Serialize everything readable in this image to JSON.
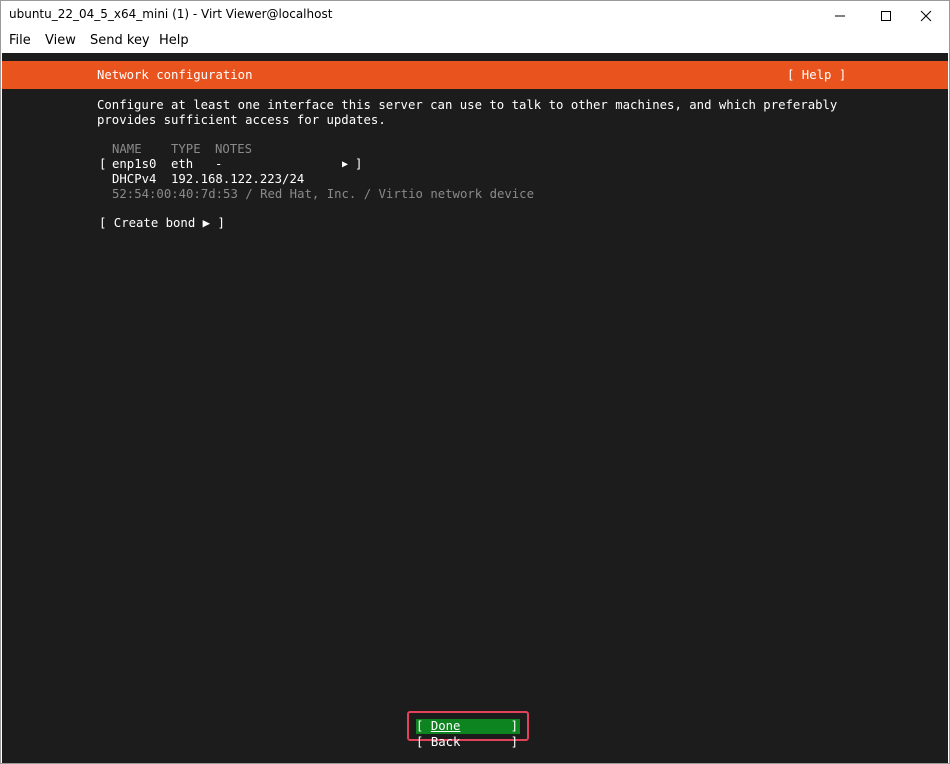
{
  "window": {
    "title": "ubuntu_22_04_5_x64_mini (1) - Virt Viewer@localhost",
    "controls": [
      "minimize",
      "maximize",
      "close"
    ]
  },
  "menu": {
    "items": [
      "File",
      "View",
      "Send key",
      "Help"
    ]
  },
  "installer": {
    "header_title": "Network configuration",
    "help_label": "[ Help ]",
    "description_line1": "Configure at least one interface this server can use to talk to other machines, and which preferably",
    "description_line2": "provides sufficient access for updates.",
    "table": {
      "headers": [
        "NAME",
        "TYPE",
        "NOTES"
      ],
      "interfaces": [
        {
          "name": "enp1s0",
          "type": "eth",
          "notes": "-",
          "open_bracket": "[",
          "arrow": "▶",
          "close_bracket": "]",
          "dhcp_label": "DHCPv4",
          "address": "192.168.122.223/24",
          "device_info": "52:54:00:40:7d:53 / Red Hat, Inc. / Virtio network device"
        }
      ]
    },
    "create_bond_label": "[ Create bond ▶ ]",
    "done_button": {
      "open": "[ ",
      "label": "Done",
      "close": "]"
    },
    "back_button": {
      "open": "[ ",
      "label": "Back",
      "close": "]"
    }
  },
  "colors": {
    "accent_orange": "#e9531e",
    "done_green": "#0e8420",
    "console_bg": "#1c1c1c",
    "highlight_red": "#e0435a"
  }
}
